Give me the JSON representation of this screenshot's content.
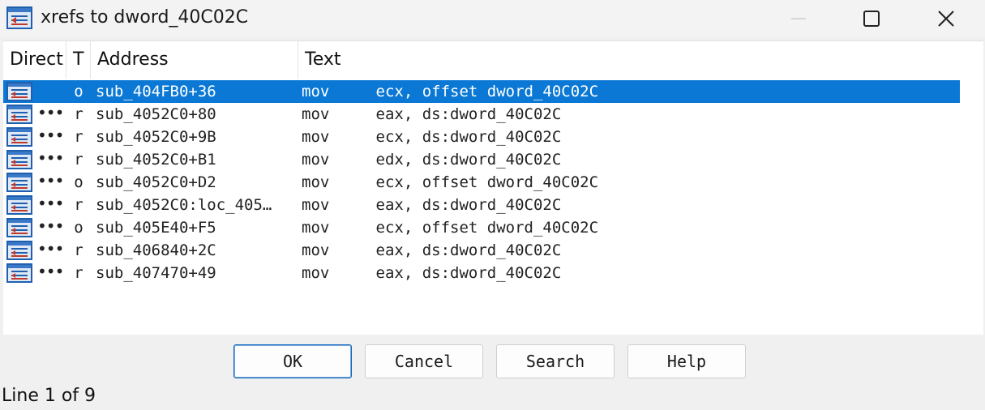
{
  "window": {
    "title": "xrefs to dword_40C02C",
    "icon": "xref-list-icon",
    "controls": [
      "minimize-icon",
      "maximize-icon",
      "close-icon"
    ]
  },
  "list": {
    "columns": [
      "Direct",
      "T",
      "Address",
      "Text"
    ],
    "selected_index": 0,
    "rows": [
      {
        "dir": "",
        "type": "o",
        "address": "sub_404FB0+36",
        "text": "mov     ecx, offset dword_40C02C"
      },
      {
        "dir": "•••",
        "type": "r",
        "address": "sub_4052C0+80",
        "text": "mov     eax, ds:dword_40C02C"
      },
      {
        "dir": "•••",
        "type": "r",
        "address": "sub_4052C0+9B",
        "text": "mov     ecx, ds:dword_40C02C"
      },
      {
        "dir": "•••",
        "type": "r",
        "address": "sub_4052C0+B1",
        "text": "mov     edx, ds:dword_40C02C"
      },
      {
        "dir": "•••",
        "type": "o",
        "address": "sub_4052C0+D2",
        "text": "mov     ecx, offset dword_40C02C"
      },
      {
        "dir": "•••",
        "type": "r",
        "address": "sub_4052C0:loc_405…",
        "text": "mov     eax, ds:dword_40C02C"
      },
      {
        "dir": "•••",
        "type": "o",
        "address": "sub_405E40+F5",
        "text": "mov     ecx, offset dword_40C02C"
      },
      {
        "dir": "•••",
        "type": "r",
        "address": "sub_406840+2C",
        "text": "mov     eax, ds:dword_40C02C"
      },
      {
        "dir": "•••",
        "type": "r",
        "address": "sub_407470+49",
        "text": "mov     eax, ds:dword_40C02C"
      }
    ]
  },
  "buttons": {
    "ok": "OK",
    "cancel": "Cancel",
    "search": "Search",
    "help": "Help"
  },
  "status": "Line 1 of 9",
  "colors": {
    "selection": "#0a78d4",
    "default_button_border": "#0a66c2"
  }
}
